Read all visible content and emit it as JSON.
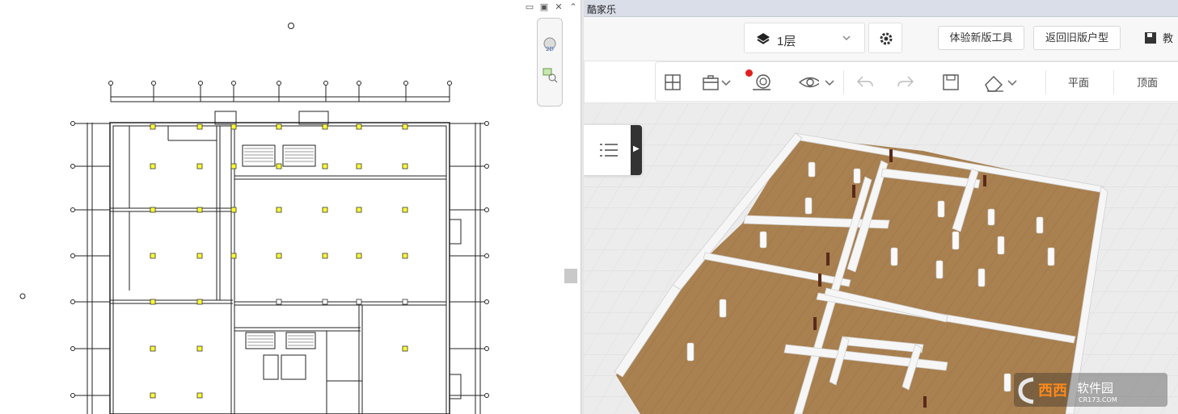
{
  "app": {
    "title": "酷家乐"
  },
  "topbar": {
    "floor_label": "1层",
    "try_new_tool": "体验新版工具",
    "back_old": "返回旧版户型",
    "save_label": "教"
  },
  "toolbar": {
    "view_plan": "平面",
    "view_top": "顶面"
  },
  "cad": {
    "window_controls": [
      "minimize-icon",
      "restore-icon",
      "close-icon",
      "collapse-icon"
    ]
  },
  "watermark": {
    "brand": "西西软件园",
    "url": "CR173.COM"
  },
  "colors": {
    "floor_wood": "#a9804f",
    "wall": "#f4f4f4",
    "column_yellow": "#ffff33",
    "titlebar": "#d9dee8"
  }
}
